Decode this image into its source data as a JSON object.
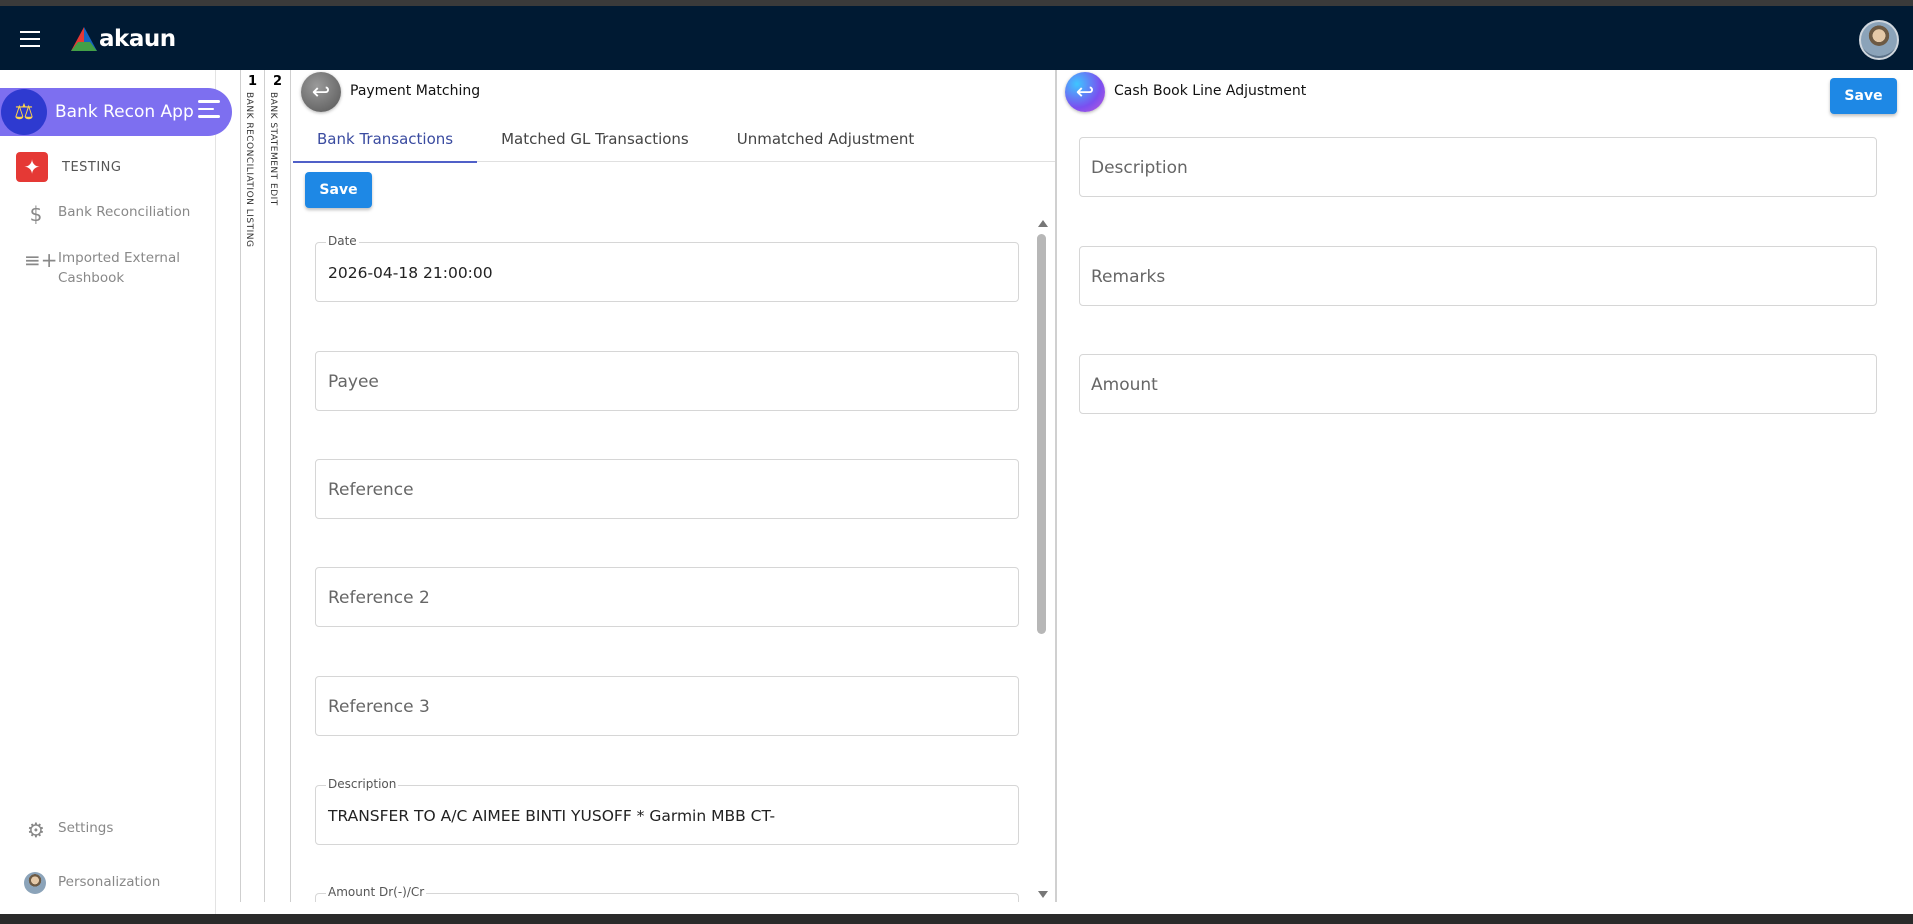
{
  "app": {
    "brand": "akaun",
    "app_name": "Bank Recon Apple",
    "org_name": "TESTING"
  },
  "sidebar": {
    "items": [
      {
        "label": "Bank Reconciliation",
        "icon": "dollar-icon"
      },
      {
        "label": "Imported External Cashbook",
        "icon": "playlist-add-icon"
      }
    ],
    "bottom": [
      {
        "label": "Settings",
        "icon": "gear-icon"
      },
      {
        "label": "Personalization",
        "icon": "avatar-icon"
      }
    ]
  },
  "vtabs": [
    {
      "num": "1",
      "label": "BANK RECONCILIATION LISTING"
    },
    {
      "num": "2",
      "label": "BANK STATEMENT EDIT"
    }
  ],
  "left_panel": {
    "title": "Payment Matching",
    "tabs": [
      "Bank Transactions",
      "Matched GL Transactions",
      "Unmatched Adjustment"
    ],
    "save_label": "Save",
    "fields": {
      "date": {
        "label": "Date",
        "value": "2026-04-18 21:00:00"
      },
      "payee": {
        "placeholder": "Payee"
      },
      "reference": {
        "placeholder": "Reference"
      },
      "reference2": {
        "placeholder": "Reference 2"
      },
      "reference3": {
        "placeholder": "Reference 3"
      },
      "description": {
        "label": "Description",
        "value": "TRANSFER TO A/C AIMEE BINTI YUSOFF * Garmin MBB CT-"
      },
      "amount": {
        "label": "Amount Dr(-)/Cr"
      }
    }
  },
  "right_panel": {
    "title": "Cash Book Line Adjustment",
    "save_label": "Save",
    "fields": {
      "description": {
        "placeholder": "Description"
      },
      "remarks": {
        "placeholder": "Remarks"
      },
      "amount": {
        "placeholder": "Amount"
      }
    }
  },
  "colors": {
    "header_bg": "#001a33",
    "accent": "#1e88e5",
    "app_pill": "#7d6ff0",
    "tab_active": "#5060c8"
  }
}
